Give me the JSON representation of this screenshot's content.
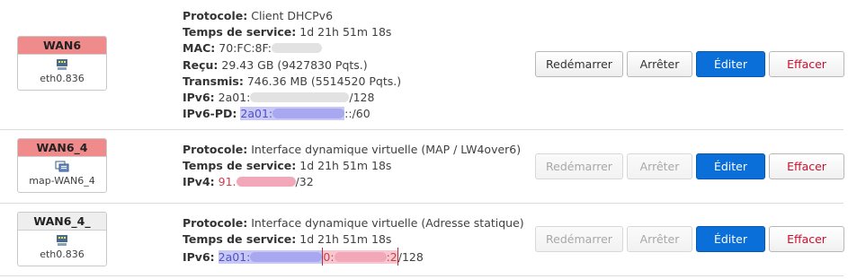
{
  "interfaces": [
    {
      "name": "WAN6",
      "device": "eth0.836",
      "icon": "ethernet-port-icon",
      "badge_color": "#f08b8b",
      "protocol_label": "Protocole:",
      "protocol": "Client DHCPv6",
      "uptime_label": "Temps de service:",
      "uptime": "1d 21h 51m 18s",
      "mac_label": "MAC:",
      "mac": "70:FC:8F:",
      "rx_label": "Reçu:",
      "rx": "29.43 GB (9427830 Pqts.)",
      "tx_label": "Transmis:",
      "tx": "746.36 MB (5514520 Pqts.)",
      "ipv6_label": "IPv6:",
      "ipv6_prefix": "2a01:",
      "ipv6_suffix": "/128",
      "ipv6pd_label": "IPv6-PD:",
      "ipv6pd_prefix": "2a01:",
      "ipv6pd_suffix": "::/60",
      "buttons": {
        "restart": "Redémarrer",
        "stop": "Arrêter",
        "edit": "Éditer",
        "delete": "Effacer"
      }
    },
    {
      "name": "WAN6_4",
      "device": "map-WAN6_4",
      "icon": "virtual-interface-icon",
      "badge_color": "#f08b8b",
      "protocol_label": "Protocole:",
      "protocol": "Interface dynamique virtuelle (MAP / LW4over6)",
      "uptime_label": "Temps de service:",
      "uptime": "1d 21h 51m 18s",
      "ipv4_label": "IPv4:",
      "ipv4_prefix": "91.",
      "ipv4_suffix": "/32",
      "buttons": {
        "restart": "Redémarrer",
        "stop": "Arrêter",
        "edit": "Éditer",
        "delete": "Effacer"
      }
    },
    {
      "name": "WAN6_4_",
      "device": "eth0.836",
      "icon": "ethernet-port-icon",
      "badge_color": "#eeeeee",
      "protocol_label": "Protocole:",
      "protocol": "Interface dynamique virtuelle (Adresse statique)",
      "uptime_label": "Temps de service:",
      "uptime": "1d 21h 51m 18s",
      "ipv6_label": "IPv6:",
      "ipv6_prefix": "2a01:",
      "ipv6_mid": "0:",
      "ipv6_tail": ":2",
      "ipv6_suffix": "/128",
      "buttons": {
        "restart": "Redémarrer",
        "stop": "Arrêter",
        "edit": "Éditer",
        "delete": "Effacer"
      }
    }
  ],
  "colors": {
    "primary": "#0a6fd8",
    "danger": "#c8102e",
    "badge_down": "#f08b8b"
  }
}
